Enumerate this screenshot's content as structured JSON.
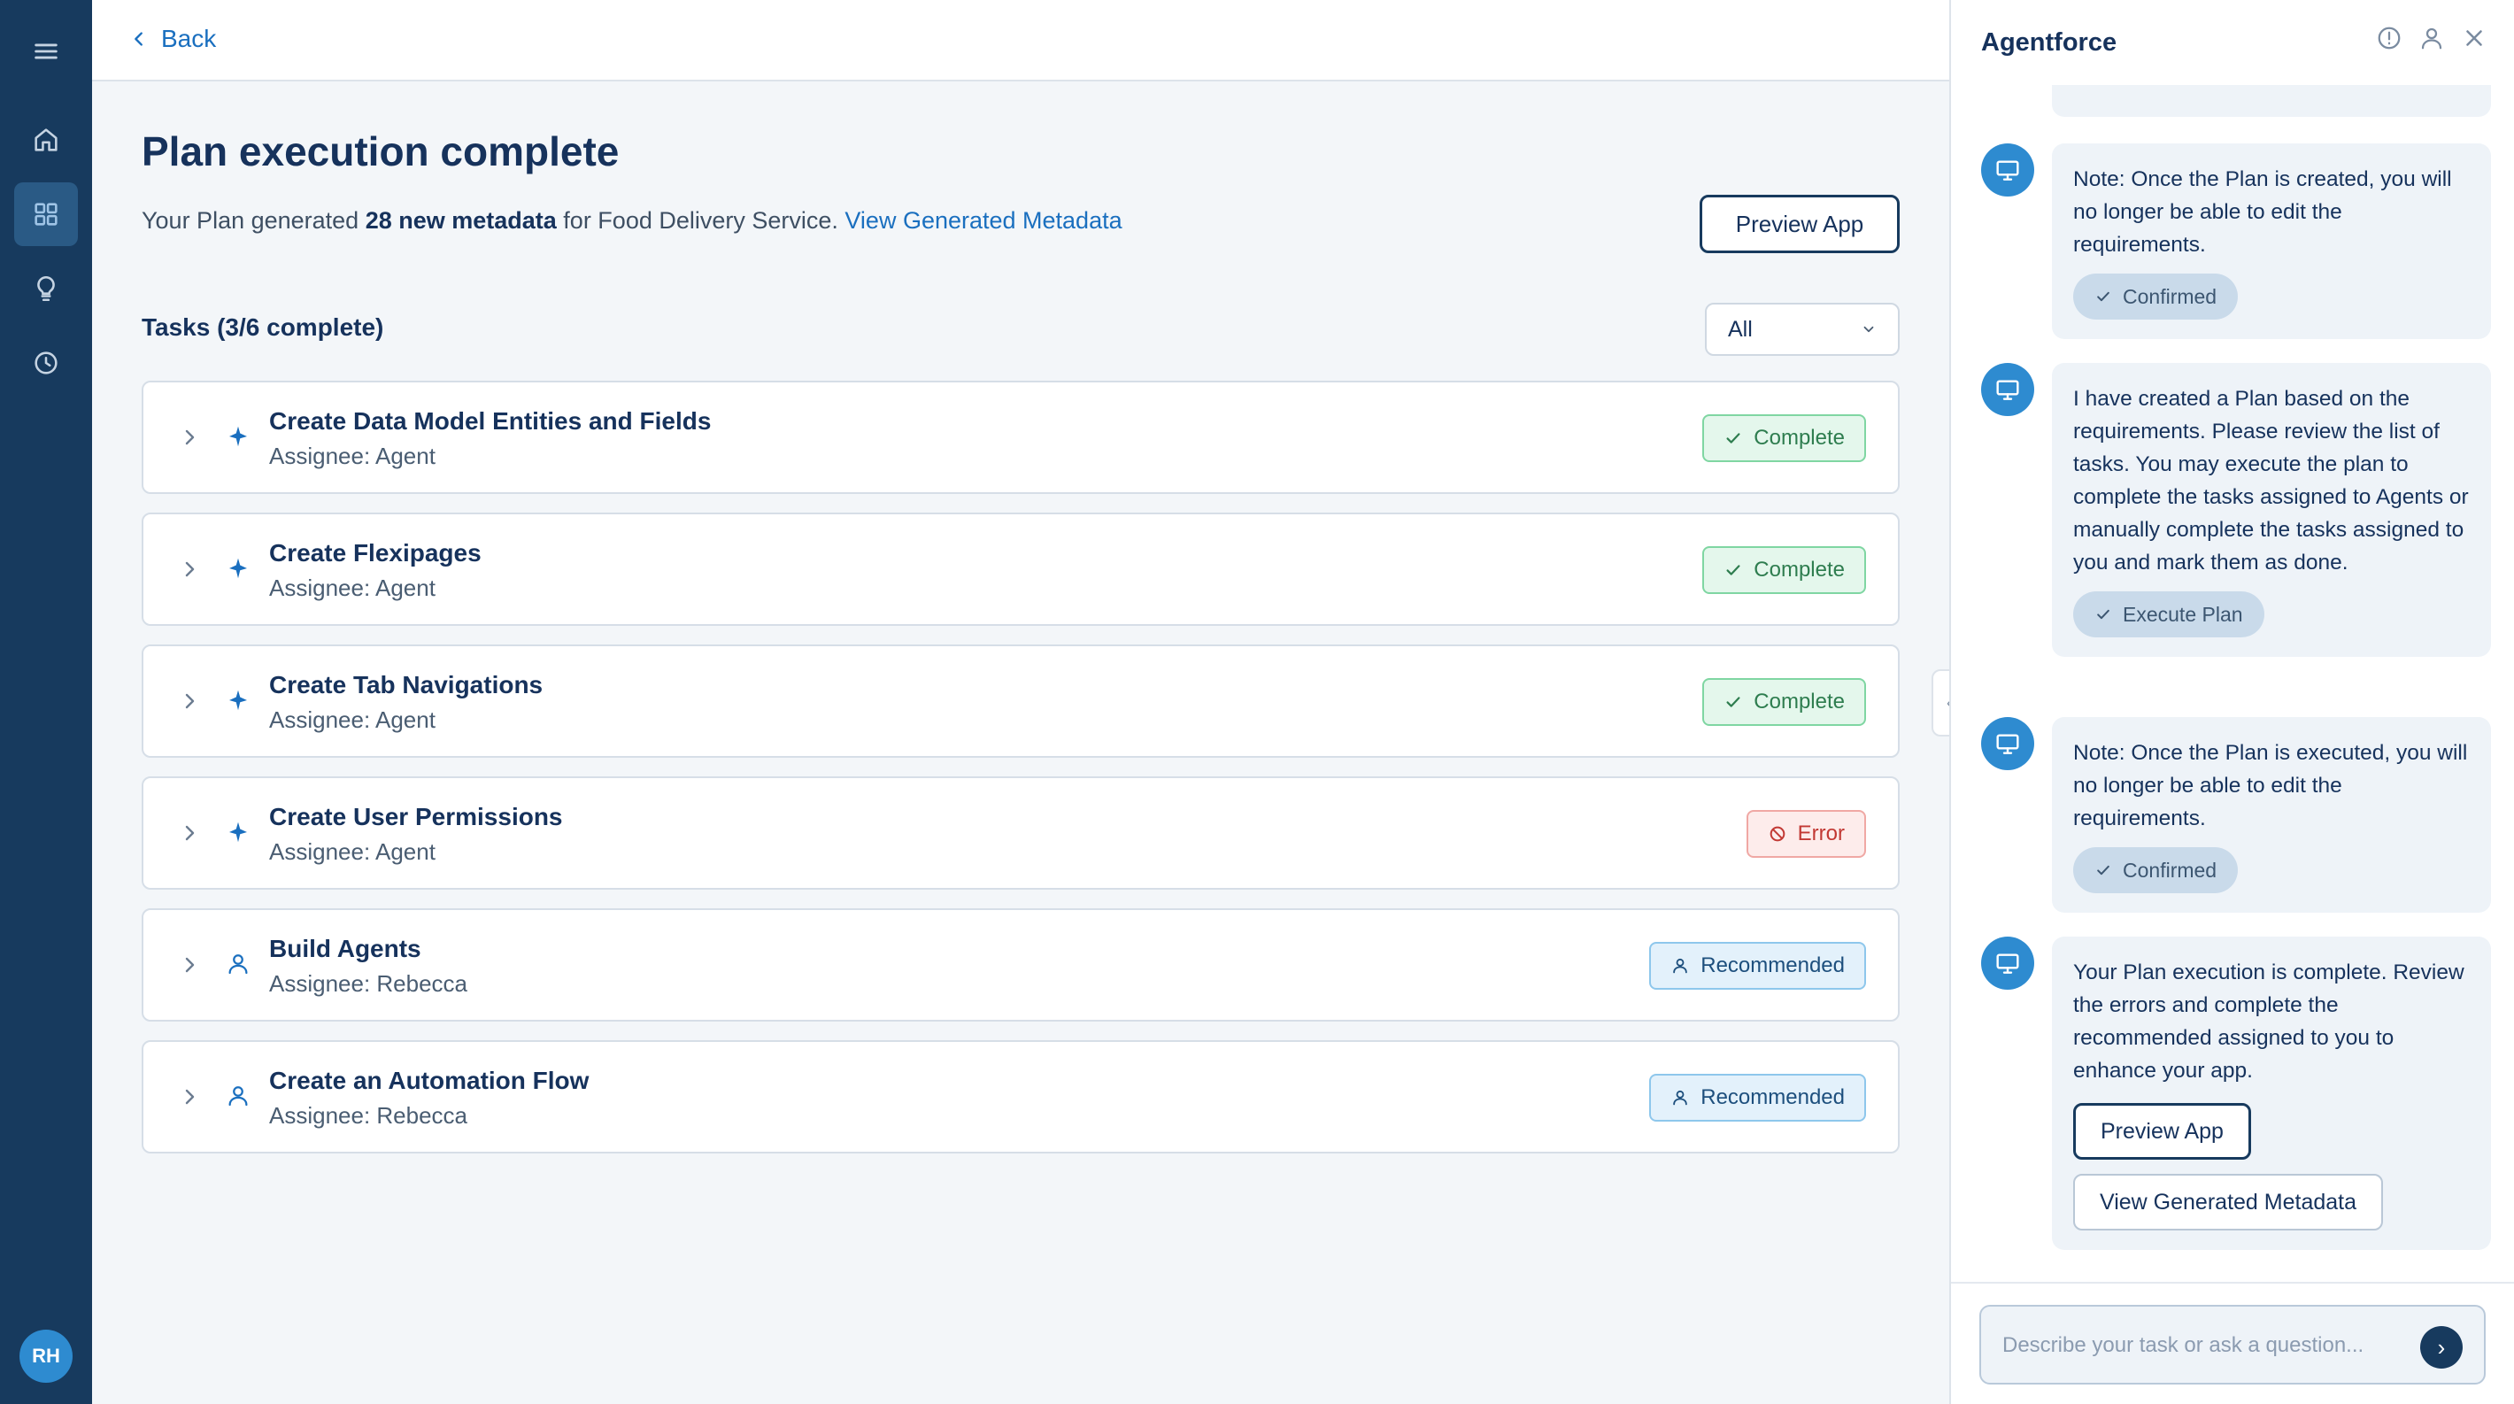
{
  "nav": {
    "items": [
      {
        "icon": "menu-icon"
      },
      {
        "icon": "home-icon"
      },
      {
        "icon": "apps-grid-icon",
        "active": true
      },
      {
        "icon": "lightbulb-icon"
      },
      {
        "icon": "clock-icon"
      }
    ],
    "avatar_initials": "RH"
  },
  "header": {
    "back_label": "Back"
  },
  "plan": {
    "title": "Plan execution complete",
    "summary_prefix": "Your Plan generated ",
    "summary_count": "28 new metadata",
    "summary_mid": " for Food Delivery Service. ",
    "summary_link": "View Generated Metadata",
    "preview_label": "Preview App",
    "tasks_heading": "Tasks (3/6 complete)",
    "filter_value": "All"
  },
  "tasks": [
    {
      "name": "Create Data Model Entities and Fields",
      "assignee": "Assignee: Agent",
      "status": "Complete",
      "type": "agent"
    },
    {
      "name": "Create Flexipages",
      "assignee": "Assignee: Agent",
      "status": "Complete",
      "type": "agent"
    },
    {
      "name": "Create Tab Navigations",
      "assignee": "Assignee: Agent",
      "status": "Complete",
      "type": "agent"
    },
    {
      "name": "Create User Permissions",
      "assignee": "Assignee: Agent",
      "status": "Error",
      "type": "agent"
    },
    {
      "name": "Build Agents",
      "assignee": "Assignee: Rebecca",
      "status": "Recommended",
      "type": "user"
    },
    {
      "name": "Create an Automation Flow",
      "assignee": "Assignee: Rebecca",
      "status": "Recommended",
      "type": "user"
    }
  ],
  "panel": {
    "title": "Agentforce",
    "icons": [
      "info-icon",
      "user-icon",
      "close-icon"
    ],
    "messages": [
      {
        "text": "Note: Once the Plan is created, you will no longer be able to edit the requirements.",
        "chip": "Confirmed"
      },
      {
        "text": "I have created a Plan based on the requirements. Please review the list of tasks. You may execute the plan to complete the tasks assigned to Agents or manually complete the tasks assigned to you and mark them as done.",
        "chip": "Execute Plan"
      },
      {
        "text": "Note: Once the Plan is executed, you will no longer be able to edit the requirements.",
        "chip": "Confirmed"
      },
      {
        "text": "Your Plan execution is complete. Review the errors and complete the recommended assigned to you to enhance your app.",
        "button_primary": "Preview App",
        "button_secondary": "View Generated Metadata"
      }
    ],
    "composer_placeholder": "Describe your task or ask a question..."
  },
  "colors": {
    "navy": "#173a5e",
    "link": "#1a6fbf",
    "complete": "#2e7d4f",
    "error": "#c23934",
    "recommended": "#1d4f7d",
    "bot_avatar": "#2e8bd0"
  }
}
